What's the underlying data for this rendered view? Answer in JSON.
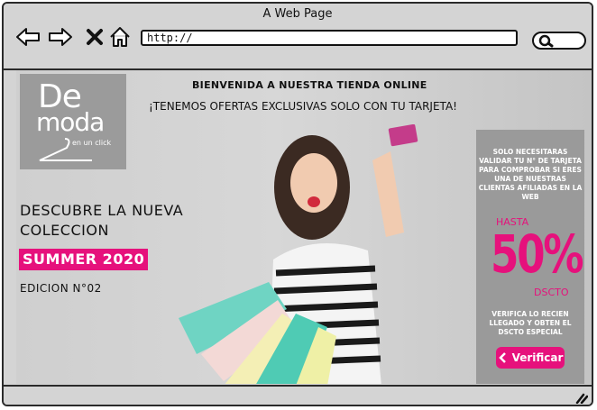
{
  "window": {
    "title": "A Web Page"
  },
  "toolbar": {
    "url": "http://"
  },
  "logo": {
    "text_top": "De",
    "text_mid": "moda",
    "text_sub": "en un click"
  },
  "header": {
    "welcome": "BIENVENIDA A NUESTRA TIENDA ONLINE",
    "offer": "¡TENEMOS OFERTAS EXCLUSIVAS SOLO CON TU TARJETA!"
  },
  "promo": {
    "discover_line1": "DESCUBRE LA NUEVA",
    "discover_line2": "COLECCION",
    "collection": "SUMMER 2020",
    "edition": "EDICION N°02"
  },
  "panel": {
    "info": "SOLO NECESITARAS VALIDAR TU N° DE TARJETA PARA COMPROBAR SI ERES UNA DE NUESTRAS CLIENTAS AFILIADAS EN LA WEB",
    "hasta": "HASTA",
    "percent": "50%",
    "dscto": "DSCTO",
    "verify_text": "VERIFICA LO RECIEN LLEGADO Y OBTEN EL DSCTO ESPECIAL",
    "verify_button": "Verificar"
  },
  "colors": {
    "accent": "#e6117c",
    "panel": "#9a9a9a",
    "chrome": "#d4d4d4"
  }
}
